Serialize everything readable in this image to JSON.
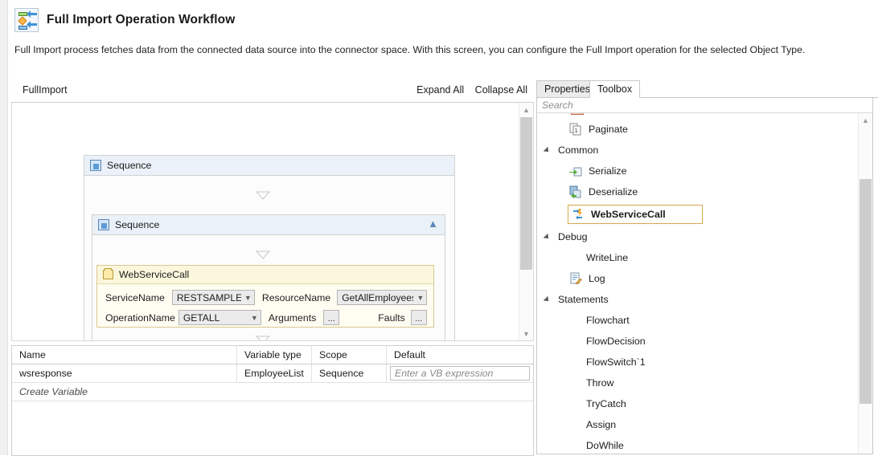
{
  "header": {
    "title": "Full Import Operation Workflow",
    "icon": "workflow-import-icon",
    "description": "Full Import process fetches data from the connected data source into the connector space. With this screen, you can configure the Full Import operation for the selected Object Type."
  },
  "designer": {
    "breadcrumb": "FullImport",
    "expand_all": "Expand All",
    "collapse_all": "Collapse All",
    "outer_sequence": {
      "label": "Sequence",
      "icon": "sequence-icon"
    },
    "inner_sequence": {
      "label": "Sequence",
      "icon": "sequence-icon",
      "collapse_icon": "chevron-up-icon"
    },
    "webservicecall": {
      "label": "WebServiceCall",
      "icon": "webservicecall-icon",
      "fields": [
        {
          "label": "ServiceName",
          "value": "RESTSAMPLE",
          "kind": "combo"
        },
        {
          "label": "ResourceName",
          "value": "GetAllEmployees",
          "kind": "combo"
        },
        {
          "label": "OperationName",
          "value": "GETALL",
          "kind": "combo"
        },
        {
          "label": "Arguments",
          "value": "...",
          "kind": "button"
        },
        {
          "label": "Faults",
          "value": "...",
          "kind": "button"
        }
      ]
    }
  },
  "variables": {
    "columns": [
      "Name",
      "Variable type",
      "Scope",
      "Default"
    ],
    "rows": [
      {
        "name": "wsresponse",
        "type": "EmployeeList",
        "scope": "Sequence",
        "default": "",
        "default_placeholder": "Enter a VB expression"
      }
    ],
    "create_label": "Create Variable"
  },
  "toolbox": {
    "tabs": [
      {
        "label": "Properties",
        "active": false
      },
      {
        "label": "Toolbox",
        "active": true
      }
    ],
    "search_placeholder": "Search",
    "items": [
      {
        "label": "Paginate",
        "type": "leaf",
        "icon": "paginate-icon",
        "selected": false
      },
      {
        "label": "Common",
        "type": "group",
        "icon": "triangle-expanded-icon"
      },
      {
        "label": "Serialize",
        "type": "leaf",
        "icon": "serialize-icon",
        "selected": false
      },
      {
        "label": "Deserialize",
        "type": "leaf",
        "icon": "deserialize-icon",
        "selected": false
      },
      {
        "label": "WebServiceCall",
        "type": "leaf",
        "icon": "webservicecall-icon",
        "selected": true
      },
      {
        "label": "Debug",
        "type": "group",
        "icon": "triangle-expanded-icon"
      },
      {
        "label": "WriteLine",
        "type": "leaf",
        "icon": "",
        "selected": false
      },
      {
        "label": "Log",
        "type": "leaf",
        "icon": "log-icon",
        "selected": false
      },
      {
        "label": "Statements",
        "type": "group",
        "icon": "triangle-expanded-icon"
      },
      {
        "label": "Flowchart",
        "type": "leaf",
        "icon": "",
        "selected": false
      },
      {
        "label": "FlowDecision",
        "type": "leaf",
        "icon": "",
        "selected": false
      },
      {
        "label": "FlowSwitch`1",
        "type": "leaf",
        "icon": "",
        "selected": false
      },
      {
        "label": "Throw",
        "type": "leaf",
        "icon": "",
        "selected": false
      },
      {
        "label": "TryCatch",
        "type": "leaf",
        "icon": "",
        "selected": false
      },
      {
        "label": "Assign",
        "type": "leaf",
        "icon": "",
        "selected": false
      },
      {
        "label": "DoWhile",
        "type": "leaf",
        "icon": "",
        "selected": false
      }
    ]
  },
  "colors": {
    "selection_border": "#d7a84f",
    "activity_header": "#fbf7dc",
    "sequence_header": "#eaf1f8",
    "tab_active_bg": "#ffffff"
  }
}
